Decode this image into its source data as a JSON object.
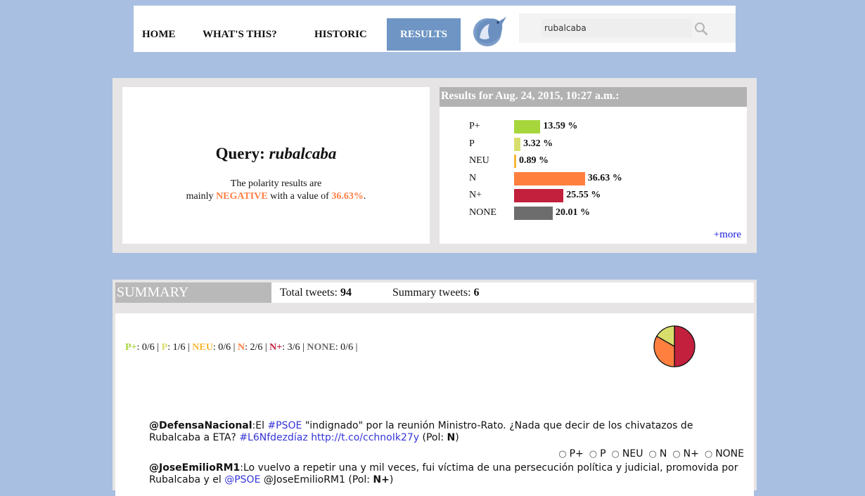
{
  "nav": {
    "items": [
      "HOME",
      "WHAT'S THIS?",
      "HISTORIC",
      "RESULTS"
    ],
    "active": "RESULTS",
    "logo_icon": "bird-logo-icon",
    "search_value": "rubalcaba"
  },
  "query": {
    "label": "Query:",
    "term": "rubalcaba",
    "desc_line1": "The polarity results are",
    "desc_pre": "mainly",
    "polarity": "NEGATIVE",
    "desc_mid": "with a value of",
    "value": "36.63%",
    "desc_end": "."
  },
  "results": {
    "header": "Results for Aug. 24, 2015, 10:27 a.m.:",
    "more": "+more",
    "bars": [
      {
        "label": "P+",
        "value": "13.59 %",
        "pct": 13.59,
        "color": "#a7d53c"
      },
      {
        "label": "P",
        "value": "3.32 %",
        "pct": 3.32,
        "color": "#d8de6b"
      },
      {
        "label": "NEU",
        "value": "0.89 %",
        "pct": 0.89,
        "color": "#f7b733"
      },
      {
        "label": "N",
        "value": "36.63 %",
        "pct": 36.63,
        "color": "#ff7f3f"
      },
      {
        "label": "N+",
        "value": "25.55 %",
        "pct": 25.55,
        "color": "#c2203d"
      },
      {
        "label": "NONE",
        "value": "20.01 %",
        "pct": 20.01,
        "color": "#6d6d6d"
      }
    ]
  },
  "summary": {
    "title": "SUMMARY",
    "total_label": "Total tweets:",
    "total": "94",
    "summary_label": "Summary tweets:",
    "summary_count": "6",
    "counts": [
      {
        "label": "P+",
        "value": ": 0/6 |",
        "color": "#a7d53c"
      },
      {
        "label": "P",
        "value": ": 1/6 |",
        "color": "#d8de6b"
      },
      {
        "label": "NEU",
        "value": ": 0/6 |",
        "color": "#f7b733"
      },
      {
        "label": "N",
        "value": ": 2/6 |",
        "color": "#ff7f3f"
      },
      {
        "label": "N+",
        "value": ": 3/6 |",
        "color": "#c2203d"
      },
      {
        "label": "NONE",
        "value": ": 0/6 |",
        "color": "#6d6d6d"
      }
    ],
    "pie": [
      {
        "label": "N+",
        "fraction": 0.5,
        "color": "#c2203d"
      },
      {
        "label": "N",
        "fraction": 0.3333,
        "color": "#ff7f3f"
      },
      {
        "label": "P",
        "fraction": 0.1667,
        "color": "#d8de6b"
      }
    ],
    "tweets": [
      {
        "user": "@DefensaNacional",
        "text1": ":El ",
        "hashtag1": "#PSOE",
        "text2": " \"indignado\" por la reunión Ministro-Rato. ¿Nada que decir de los chivatazos de Rubalcaba a ETA? ",
        "hashtag2": "#L6Nfdezdíaz",
        "link": "http://t.co/cchnoIk27y",
        "pol_label": "(Pol: ",
        "pol": "N",
        "pol_end": ")"
      },
      {
        "user": "@JoseEmilioRM1",
        "text1": ":Lo vuelvo a repetir una y mil veces, fui víctima de una persecución política y judicial, promovida por Rubalcaba y el ",
        "mention": "@PSOE",
        "text2": " @JoseEmilioRM1 ",
        "pol_label": "(Pol: ",
        "pol": "N+",
        "pol_end": ")"
      }
    ],
    "radio_options": [
      "P+",
      "P",
      "NEU",
      "N",
      "N+",
      "NONE"
    ]
  }
}
